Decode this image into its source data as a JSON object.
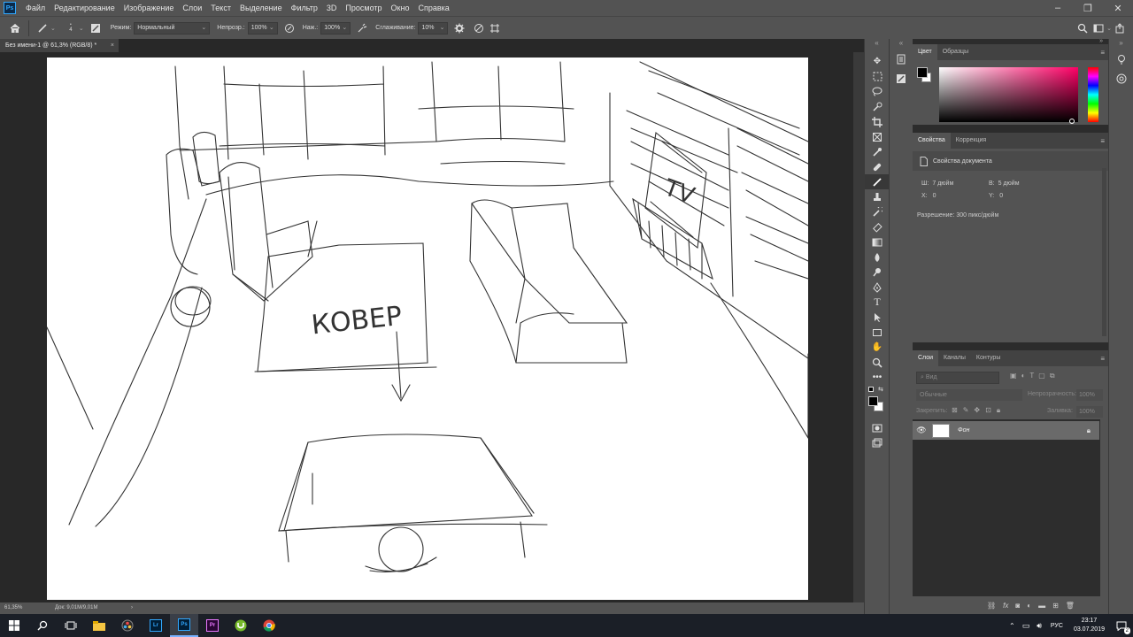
{
  "menu": {
    "app_icon": "Ps",
    "items": [
      "Файл",
      "Редактирование",
      "Изображение",
      "Слои",
      "Текст",
      "Выделение",
      "Фильтр",
      "3D",
      "Просмотр",
      "Окно",
      "Справка"
    ]
  },
  "options": {
    "mode_label": "Режим:",
    "mode_value": "Нормальный",
    "opacity_label": "Непрозр.:",
    "opacity_value": "100%",
    "flow_label": "Наж.:",
    "flow_value": "100%",
    "smoothing_label": "Сглаживание:",
    "smoothing_value": "10%",
    "brush_size": "4"
  },
  "document": {
    "tab_title": "Без имени-1 @ 61,3% (RGB/8) *",
    "close_glyph": "×",
    "sketch_text_carpet": "КОВЕР",
    "sketch_text_tv": "TV"
  },
  "status": {
    "zoom": "61,35%",
    "doc_size": "Док: 9,01M/9,01M",
    "arrow": "›"
  },
  "color_panel": {
    "tabs": [
      "Цвет",
      "Образцы"
    ],
    "fg_color": "#000000",
    "bg_color": "#ffffff",
    "hue_color": "#ff0066"
  },
  "properties_panel": {
    "tabs": [
      "Свойства",
      "Коррекция"
    ],
    "doc_props_label": "Свойства документа",
    "width_label": "Ш:",
    "width_value": "7 дюйм",
    "height_label": "В:",
    "height_value": "5 дюйм",
    "x_label": "X:",
    "x_value": "0",
    "y_label": "Y:",
    "y_value": "0",
    "resolution": "Разрешение: 300 пикс/дюйм"
  },
  "layers_panel": {
    "tabs": [
      "Слои",
      "Каналы",
      "Контуры"
    ],
    "search_placeholder": "Вид",
    "blend_mode": "Обычные",
    "opacity_label": "Непрозрачность:",
    "opacity_value": "100%",
    "lock_label": "Закрепить:",
    "fill_label": "Заливка:",
    "fill_value": "100%",
    "layers": [
      {
        "name": "Фон"
      }
    ]
  },
  "taskbar": {
    "time": "23:17",
    "date": "03.07.2019",
    "lang": "РУС",
    "notif_count": "2",
    "apps": [
      "Ps",
      "Pr",
      "Lr"
    ]
  }
}
